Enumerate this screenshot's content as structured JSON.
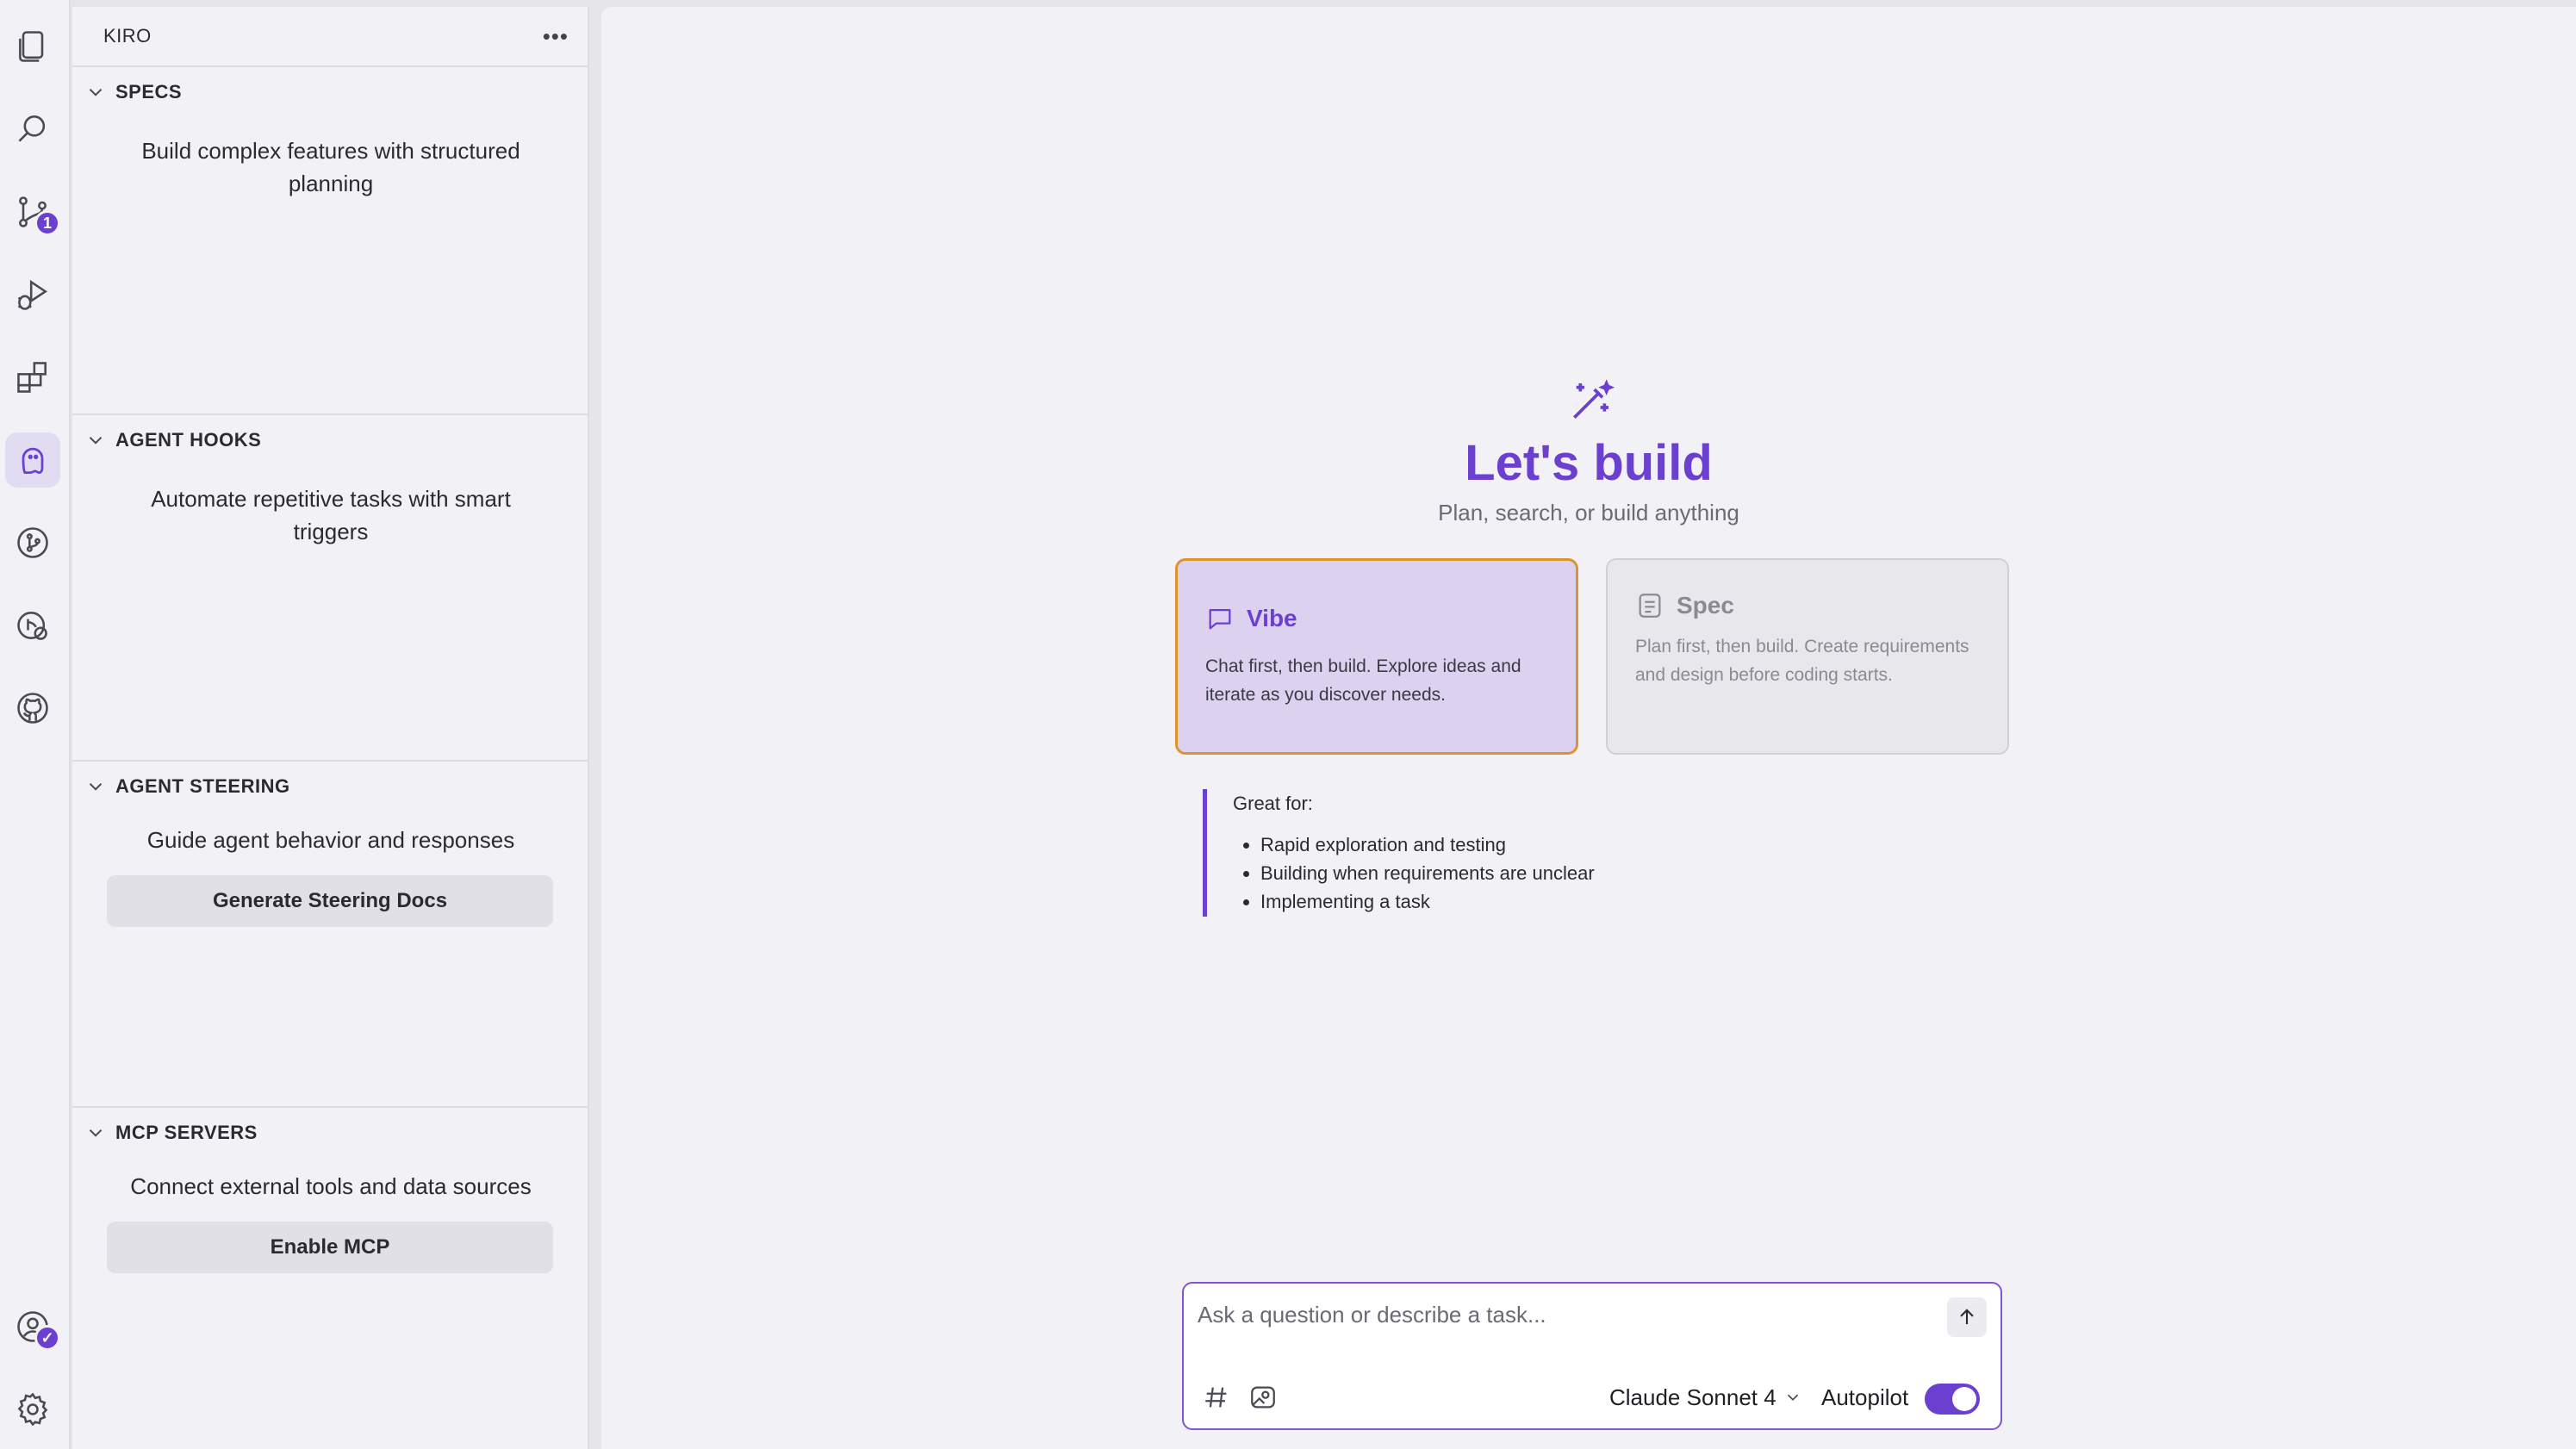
{
  "activity_bar": {
    "source_control_badge": "1",
    "items": [
      {
        "name": "explorer-icon"
      },
      {
        "name": "search-icon"
      },
      {
        "name": "source-control-icon"
      },
      {
        "name": "run-debug-icon"
      },
      {
        "name": "extensions-icon"
      },
      {
        "name": "kiro-ghost-icon"
      },
      {
        "name": "git-graph-icon"
      },
      {
        "name": "remote-explorer-icon"
      },
      {
        "name": "github-icon"
      },
      {
        "name": "account-icon"
      },
      {
        "name": "settings-gear-icon"
      }
    ]
  },
  "side_panel": {
    "title": "KIRO",
    "more_label": "•••",
    "sections": {
      "specs": {
        "title": "SPECS",
        "description": "Build complex features with structured planning"
      },
      "agent_hooks": {
        "title": "AGENT HOOKS",
        "description": "Automate repetitive tasks with smart triggers"
      },
      "agent_steering": {
        "title": "AGENT STEERING",
        "description": "Guide agent behavior and responses",
        "button": "Generate Steering Docs"
      },
      "mcp_servers": {
        "title": "MCP SERVERS",
        "description": "Connect external tools and data sources",
        "button": "Enable MCP"
      }
    }
  },
  "main": {
    "title": "Let's build",
    "subtitle": "Plan, search, or build anything",
    "modes": {
      "vibe": {
        "title": "Vibe",
        "description": "Chat first, then build. Explore ideas and iterate as you discover needs.",
        "selected": true
      },
      "spec": {
        "title": "Spec",
        "description": "Plan first, then build. Create requirements and design before coding starts.",
        "selected": false
      }
    },
    "great_for": {
      "title": "Great for:",
      "items": [
        "Rapid exploration and testing",
        "Building when requirements are unclear",
        "Implementing a task"
      ]
    }
  },
  "chat": {
    "placeholder": "Ask a question or describe a task...",
    "model": "Claude Sonnet 4",
    "autopilot_label": "Autopilot",
    "autopilot_on": true
  },
  "colors": {
    "accent": "#6b3fd0",
    "vibe_card_bg": "#dcd2f0",
    "vibe_card_border": "#d9962e",
    "background": "#f2f2f6"
  }
}
